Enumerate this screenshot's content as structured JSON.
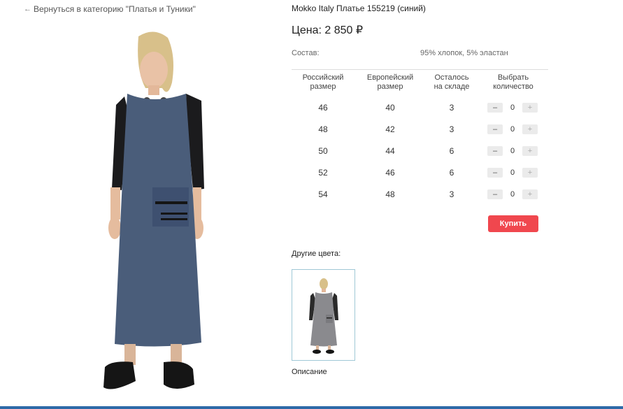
{
  "nav": {
    "back_arrow": "←",
    "back_label": "Вернуться в категорию \"Платья и Туники\""
  },
  "product": {
    "title": "Mokko Italy Платье 155219 (синий)",
    "price": "Цена: 2 850 ₽",
    "composition_label": "Состав:",
    "composition_value": "95% хлопок, 5% эластан",
    "image_icon": "dress-photo"
  },
  "table": {
    "headers": [
      "Российский\nразмер",
      "Европейский\nразмер",
      "Осталось\nна складе",
      "Выбрать\nколичество"
    ],
    "rows": [
      {
        "ru": "46",
        "eu": "40",
        "stock": "3",
        "qty": "0"
      },
      {
        "ru": "48",
        "eu": "42",
        "stock": "3",
        "qty": "0"
      },
      {
        "ru": "50",
        "eu": "44",
        "stock": "6",
        "qty": "0"
      },
      {
        "ru": "52",
        "eu": "46",
        "stock": "6",
        "qty": "0"
      },
      {
        "ru": "54",
        "eu": "48",
        "stock": "3",
        "qty": "0"
      }
    ],
    "minus_label": "–",
    "plus_label": "+"
  },
  "buy_label": "Купить",
  "other_colors_label": "Другие цвета:",
  "description_label": "Описание",
  "colors": {
    "accent": "#f0474e",
    "thumb_border": "#9fc8d6",
    "dress_main": "#4a5d7a",
    "dress_thumb": "#8a8a8e"
  }
}
